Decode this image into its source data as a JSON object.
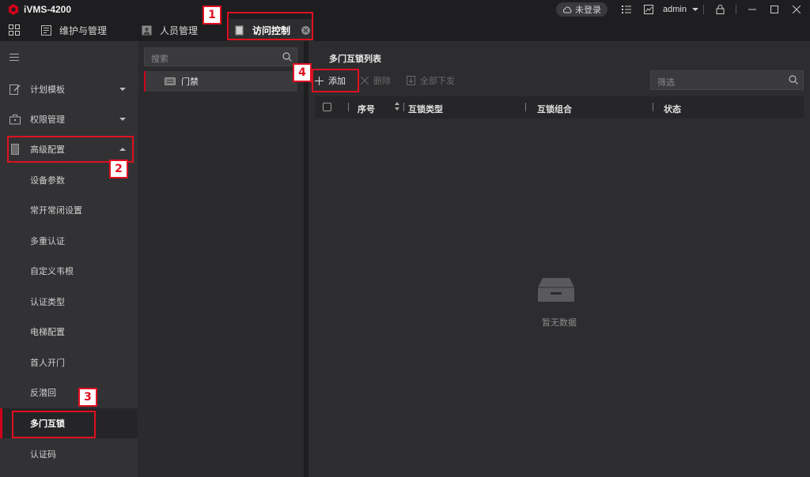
{
  "app": {
    "title": "iVMS-4200"
  },
  "titlebar": {
    "login_status": "未登录",
    "user": "admin"
  },
  "tabs": [
    {
      "label": "维护与管理",
      "icon": "maintenance-icon"
    },
    {
      "label": "人员管理",
      "icon": "person-icon"
    },
    {
      "label": "访问控制",
      "icon": "access-control-icon",
      "active": true
    }
  ],
  "sidebar": {
    "items": [
      {
        "label": "计划模板",
        "expandable": true
      },
      {
        "label": "权限管理",
        "expandable": true
      },
      {
        "label": "高级配置",
        "expandable": true,
        "expanded": true
      },
      {
        "label": "设备参数"
      },
      {
        "label": "常开常闭设置"
      },
      {
        "label": "多重认证"
      },
      {
        "label": "自定义韦根"
      },
      {
        "label": "认证类型"
      },
      {
        "label": "电梯配置"
      },
      {
        "label": "首人开门"
      },
      {
        "label": "反潜回"
      },
      {
        "label": "多门互锁",
        "selected": true
      },
      {
        "label": "认证码"
      }
    ]
  },
  "tree": {
    "search_placeholder": "搜索",
    "node": "门禁"
  },
  "main": {
    "title": "多门互锁列表",
    "toolbar": {
      "add": "添加",
      "delete": "删除",
      "download_all": "全部下发"
    },
    "filter_placeholder": "筛选",
    "columns": [
      "序号",
      "互锁类型",
      "互锁组合",
      "状态"
    ],
    "empty_text": "暂无数据"
  },
  "annotations": [
    "1",
    "2",
    "3",
    "4"
  ],
  "colors": {
    "accent": "#d0021b",
    "annotation": "#e01020"
  }
}
